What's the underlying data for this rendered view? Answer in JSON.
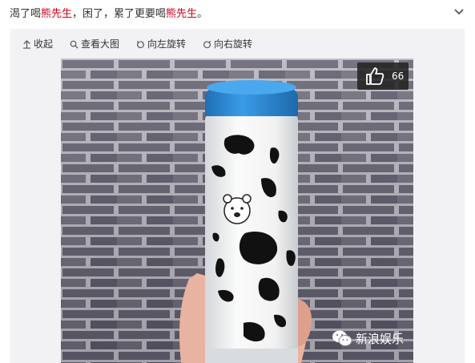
{
  "post": {
    "text_before": "渴了喝",
    "highlight_1": "熊先生",
    "text_middle": "，困了，累了更要喝",
    "highlight_2": "熊先生",
    "text_after": "。"
  },
  "toolbar": {
    "collapse_label": "收起",
    "view_large_label": "查看大图",
    "rotate_left_label": "向左旋转",
    "rotate_right_label": "向右旋转"
  },
  "photo": {
    "like_count": "66",
    "watermark_text": "新浪娱乐"
  },
  "colors": {
    "highlight": "#d0021b",
    "panel_bg": "#f2f2f5",
    "cap_blue": "#2f8fdc"
  }
}
